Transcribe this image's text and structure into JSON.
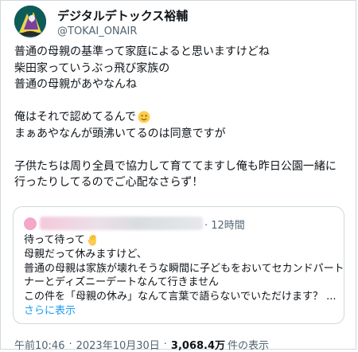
{
  "author": {
    "display_name": "デジタルデトックス裕輔",
    "handle": "@TOKAI_ONAIR"
  },
  "tweet": {
    "lines": [
      "普通の母親の基準って家庭によると思いますけどね",
      "柴田家っていうぶっ飛び家族の",
      "普通の母親があやなんね",
      "",
      "俺はそれで認めてるんで",
      "まぁあやなんが頭沸いてるのは同意ですが",
      "",
      "子供たちは周り全員で協力して育ててますし俺も昨日公園一緒に",
      "行ったりしてるのでご心配なさらず！"
    ],
    "emoji_after_line_5": "winking-face"
  },
  "quote": {
    "time": "· 12時間",
    "lines": [
      "待って待って",
      "母親だって休みますけど、",
      "普通の母親は家族が壊れそうな瞬間に子どもをおいてセカンドパート",
      "ナーとディズニーデートなんて行きません",
      "この件を「母親の休み」なんて言葉で語らないでいただけます？ ..."
    ],
    "show_more": "さらに表示"
  },
  "meta": {
    "time": "午前10:46",
    "dot": "·",
    "date": "2023年10月30日",
    "views_count": "3,068.4万",
    "views_label": "件の表示"
  },
  "colors": {
    "text": "#0f1419",
    "secondary": "#536471",
    "link": "#1d9bf0",
    "border": "#cfd9de"
  }
}
